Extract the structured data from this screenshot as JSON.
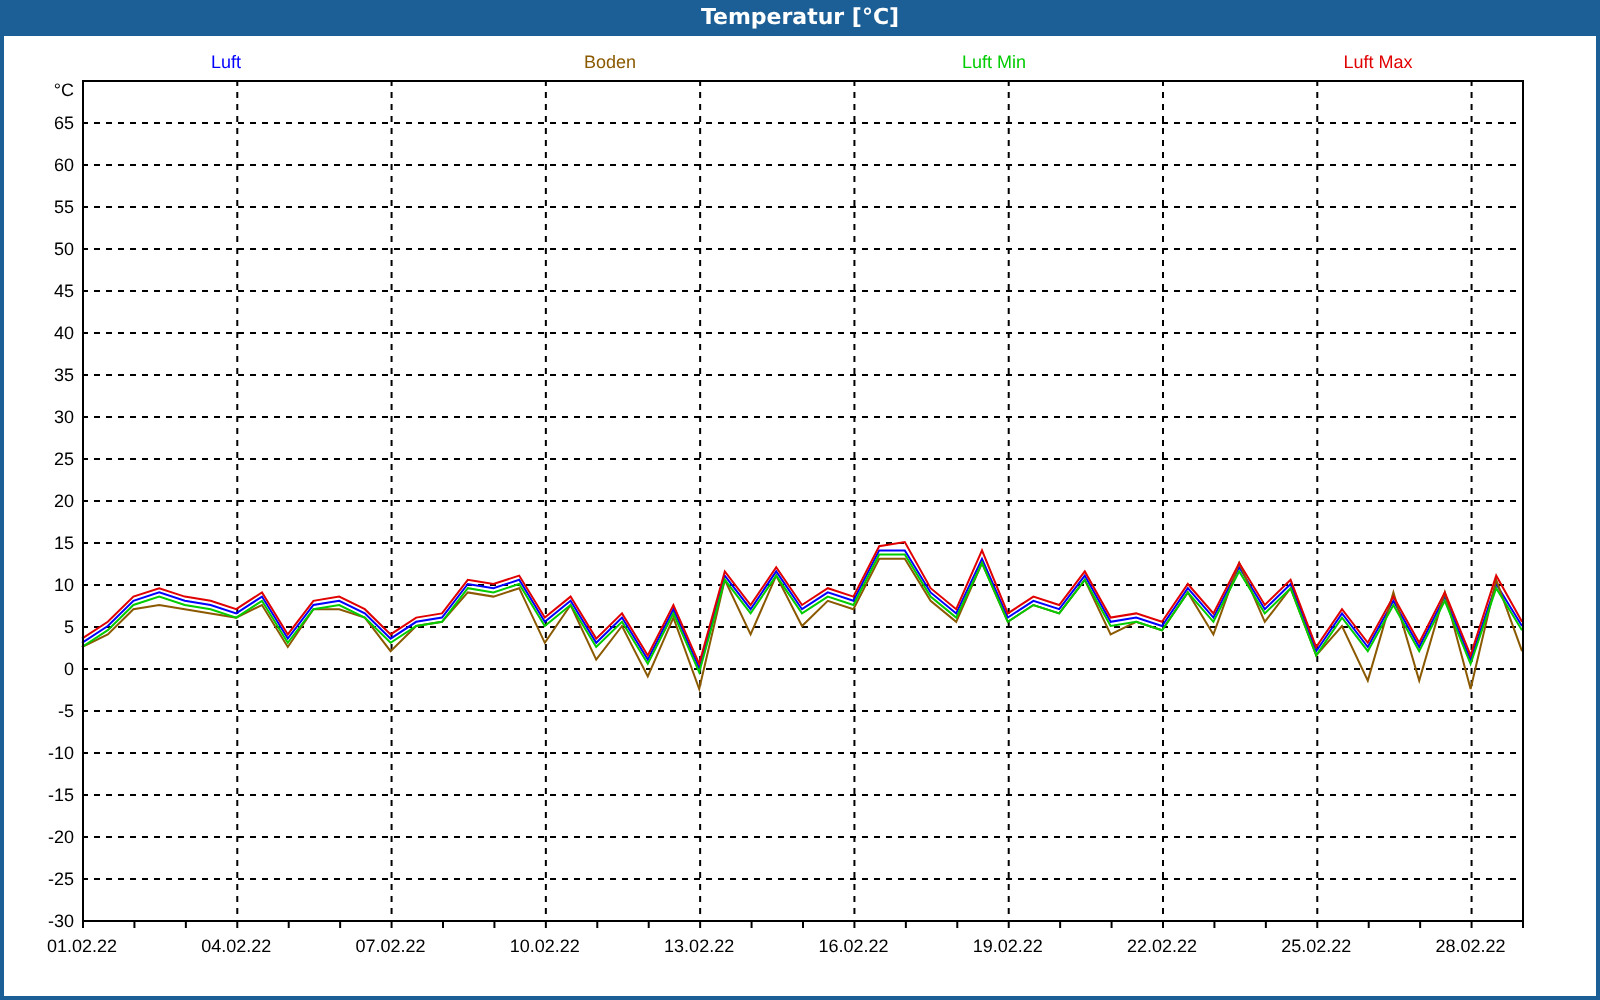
{
  "window": {
    "title": "Temperatur [°C]"
  },
  "chart": {
    "chart_data": {
      "type": "line",
      "ylabel": "°C",
      "ylim": [
        -30,
        70
      ],
      "grid": true,
      "yticks": [
        -30,
        -25,
        -20,
        -15,
        -10,
        -5,
        0,
        5,
        10,
        15,
        20,
        25,
        30,
        35,
        40,
        45,
        50,
        55,
        60,
        65
      ],
      "categories": [
        "01.02.22",
        null,
        null,
        null,
        null,
        null,
        "04.02.22",
        null,
        null,
        null,
        null,
        null,
        "07.02.22",
        null,
        null,
        null,
        null,
        null,
        "10.02.22",
        null,
        null,
        null,
        null,
        null,
        "13.02.22",
        null,
        null,
        null,
        null,
        null,
        "16.02.22",
        null,
        null,
        null,
        null,
        null,
        "19.02.22",
        null,
        null,
        null,
        null,
        null,
        "22.02.22",
        null,
        null,
        null,
        null,
        null,
        "25.02.22",
        null,
        null,
        null,
        null,
        null,
        "28.02.22",
        null,
        null
      ],
      "series": [
        {
          "name": "Luft",
          "color": "#0000ff",
          "values": [
            3,
            5,
            8,
            9,
            8,
            7.5,
            6.5,
            8.5,
            3.5,
            7.5,
            8,
            6.5,
            3.5,
            5.5,
            6,
            10,
            9.5,
            10.5,
            5.5,
            8,
            3,
            6,
            1,
            7,
            0,
            11,
            7,
            11.5,
            7,
            9,
            8,
            14,
            14,
            9,
            6.5,
            13,
            6,
            8,
            7,
            11,
            5.5,
            6,
            5,
            9.5,
            6,
            12,
            7,
            10,
            2,
            6.5,
            2.5,
            8,
            2.5,
            8.5,
            1,
            10,
            5
          ]
        },
        {
          "name": "Boden",
          "color": "#8b5a00",
          "values": [
            2.5,
            4,
            7,
            7.5,
            7,
            6.5,
            6,
            7.5,
            2.5,
            7,
            7,
            6,
            2,
            5,
            5.5,
            9,
            8.5,
            9.5,
            3,
            7.5,
            1,
            5,
            -1,
            6,
            -2.5,
            10.5,
            4,
            11,
            5,
            8,
            7,
            13,
            13,
            8,
            5.5,
            12.5,
            5.5,
            7.5,
            6.5,
            10.5,
            4,
            5.5,
            4.5,
            9,
            4,
            12.5,
            5.5,
            9.5,
            1.5,
            5,
            -1.5,
            9,
            -1.5,
            9,
            -2.5,
            10.5,
            2
          ]
        },
        {
          "name": "Luft Min",
          "color": "#00cc00",
          "values": [
            2.5,
            4.5,
            7.5,
            8.5,
            7.5,
            7,
            6,
            8,
            3,
            7,
            7.5,
            6,
            3,
            5,
            5.5,
            9.5,
            9,
            10,
            5,
            7.5,
            2.5,
            5.5,
            0.5,
            6.5,
            -0.5,
            10.5,
            6.5,
            11,
            6.5,
            8.5,
            7.5,
            13.5,
            13.5,
            8.5,
            6,
            12.5,
            5.5,
            7.5,
            6.5,
            10.5,
            5,
            5.5,
            4.5,
            9,
            5.5,
            11.5,
            6.5,
            9.5,
            1.5,
            6,
            2,
            7.5,
            2,
            8,
            0.5,
            9.5,
            4.5
          ]
        },
        {
          "name": "Luft Max",
          "color": "#e00000",
          "values": [
            3.5,
            5.5,
            8.5,
            9.5,
            8.5,
            8,
            7,
            9,
            4,
            8,
            8.5,
            7,
            4,
            6,
            6.5,
            10.5,
            10,
            11,
            6,
            8.5,
            3.5,
            6.5,
            1.5,
            7.5,
            0.5,
            11.5,
            7.5,
            12,
            7.5,
            9.5,
            8.5,
            14.5,
            15,
            9.5,
            7,
            14,
            6.5,
            8.5,
            7.5,
            11.5,
            6,
            6.5,
            5.5,
            10,
            6.5,
            12.5,
            7.5,
            10.5,
            2.5,
            7,
            3,
            8.5,
            3,
            9,
            1.5,
            11,
            5.5
          ]
        }
      ]
    }
  }
}
